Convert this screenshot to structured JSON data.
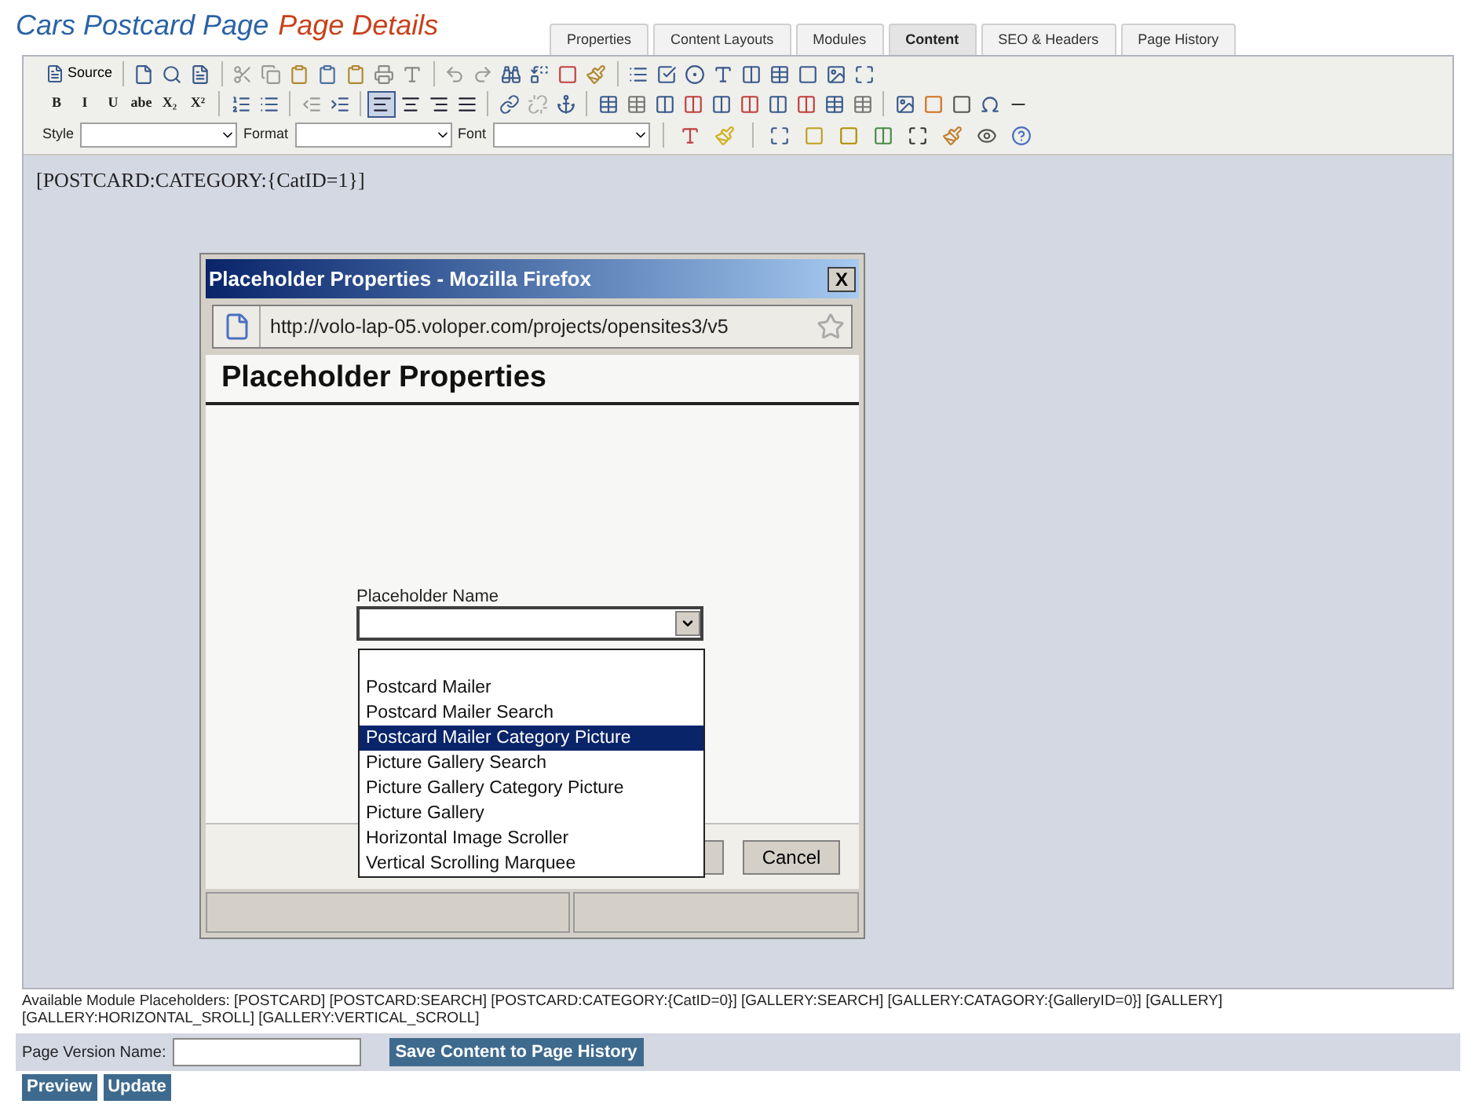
{
  "header": {
    "title": "Cars Postcard Page",
    "subtitle": "Page Details"
  },
  "tabs": [
    {
      "label": "Properties",
      "selected": false
    },
    {
      "label": "Content Layouts",
      "selected": false
    },
    {
      "label": "Modules",
      "selected": false
    },
    {
      "label": "Content",
      "selected": true
    },
    {
      "label": "SEO & Headers",
      "selected": false
    },
    {
      "label": "Page History",
      "selected": false
    }
  ],
  "toolbar": {
    "source_label": "Source",
    "format_buttons": [
      "B",
      "I",
      "U",
      "abe",
      "X₂",
      "X²"
    ],
    "alignment_buttons": [
      {
        "selected": true
      },
      {
        "selected": false
      },
      {
        "selected": false
      },
      {
        "selected": false
      }
    ],
    "combos": [
      {
        "label": "Style"
      },
      {
        "label": "Format"
      },
      {
        "label": "Font"
      }
    ]
  },
  "editor": {
    "content": "[POSTCARD:CATEGORY:{CatID=1}]"
  },
  "dialog": {
    "window_title": "Placeholder Properties - Mozilla Firefox",
    "close_label": "X",
    "url": "http://volo-lap-05.voloper.com/projects/opensites3/v5",
    "heading": "Placeholder Properties",
    "field_label": "Placeholder Name",
    "options": [
      {
        "label": "Postcard Mailer",
        "selected": false
      },
      {
        "label": "Postcard Mailer Search",
        "selected": false
      },
      {
        "label": "Postcard Mailer Category Picture",
        "selected": true
      },
      {
        "label": "Picture Gallery Search",
        "selected": false
      },
      {
        "label": "Picture Gallery Category Picture",
        "selected": false
      },
      {
        "label": "Picture Gallery",
        "selected": false
      },
      {
        "label": "Horizontal Image Scroller",
        "selected": false
      },
      {
        "label": "Vertical Scrolling Marquee",
        "selected": false
      }
    ],
    "cancel_label": "Cancel"
  },
  "placeholders_note": "Available Module Placeholders: [POSTCARD] [POSTCARD:SEARCH] [POSTCARD:CATEGORY:{CatID=0}] [GALLERY:SEARCH] [GALLERY:CATAGORY:{GalleryID=0}] [GALLERY] [GALLERY:HORIZONTAL_SROLL] [GALLERY:VERTICAL_SCROLL]",
  "version": {
    "label": "Page Version Name:",
    "save_label": "Save Content to Page History"
  },
  "actions": [
    "Preview",
    "Update"
  ]
}
